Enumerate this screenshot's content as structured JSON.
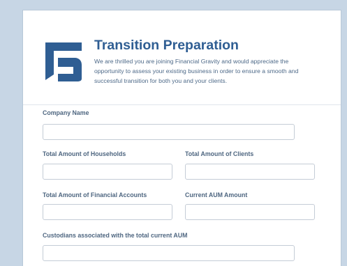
{
  "form": {
    "title": "Transition Preparation",
    "description": "We are thrilled you are joining Financial Gravity and would appreciate the opportunity to assess your existing business in order to ensure a smooth and successful transition for both you and your clients.",
    "brand_color": "#2f5e93",
    "logo_icon": "financial-gravity-logo-icon"
  },
  "fields": {
    "company_name": {
      "label": "Company Name",
      "value": ""
    },
    "total_households": {
      "label": "Total Amount of Households",
      "value": ""
    },
    "total_clients": {
      "label": "Total Amount of Clients",
      "value": ""
    },
    "total_financial_accounts": {
      "label": "Total Amount of Financial Accounts",
      "value": ""
    },
    "current_aum": {
      "label": "Current AUM Amount",
      "value": ""
    },
    "custodians": {
      "label": "Custodians associated with the total current AUM",
      "value": ""
    }
  },
  "colors": {
    "page_background": "#c7d6e5",
    "card_background": "#ffffff",
    "label_text": "#4e6680",
    "field_border": "#c4ccd6"
  }
}
